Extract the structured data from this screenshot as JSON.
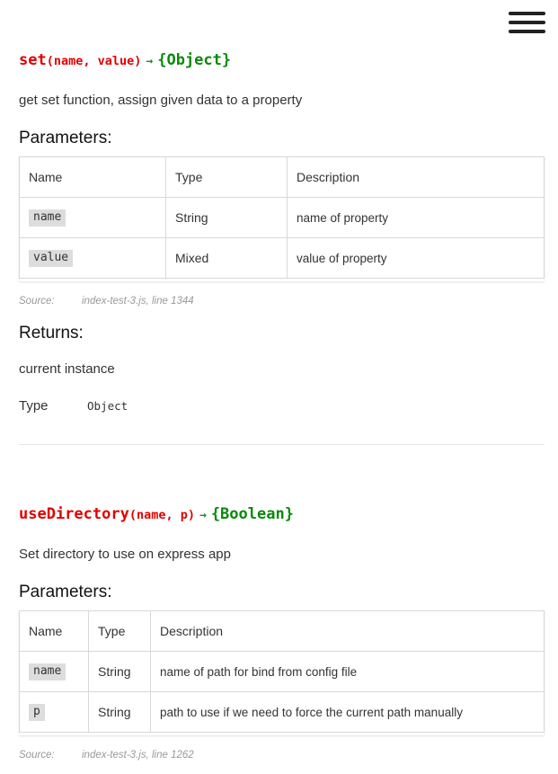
{
  "nav": {
    "menu_icon": "hamburger-menu-icon"
  },
  "methods": [
    {
      "name": "set",
      "params_sig": "(name, value)",
      "arrow": "→",
      "returns_sig": "{Object}",
      "description": "get set function, assign given data to a property",
      "parameters_heading": "Parameters:",
      "columns": [
        "Name",
        "Type",
        "Description"
      ],
      "rows": [
        {
          "name": "name",
          "type": "String",
          "description": "name of property"
        },
        {
          "name": "value",
          "type": "Mixed",
          "description": "value of property"
        }
      ],
      "source_label": "Source:",
      "source_value": "index-test-3.js, line 1344",
      "returns_heading": "Returns:",
      "returns_description": "current instance",
      "type_label": "Type",
      "type_value": "Object"
    },
    {
      "name": "useDirectory",
      "params_sig": "(name, p)",
      "arrow": "→",
      "returns_sig": "{Boolean}",
      "description": "Set directory to use on express app",
      "parameters_heading": "Parameters:",
      "columns": [
        "Name",
        "Type",
        "Description"
      ],
      "rows": [
        {
          "name": "name",
          "type": "String",
          "description": "name of path for bind from config file"
        },
        {
          "name": "p",
          "type": "String",
          "description": "path to use if we need to force the current path manually"
        }
      ],
      "source_label": "Source:",
      "source_value": "index-test-3.js, line 1262"
    }
  ]
}
